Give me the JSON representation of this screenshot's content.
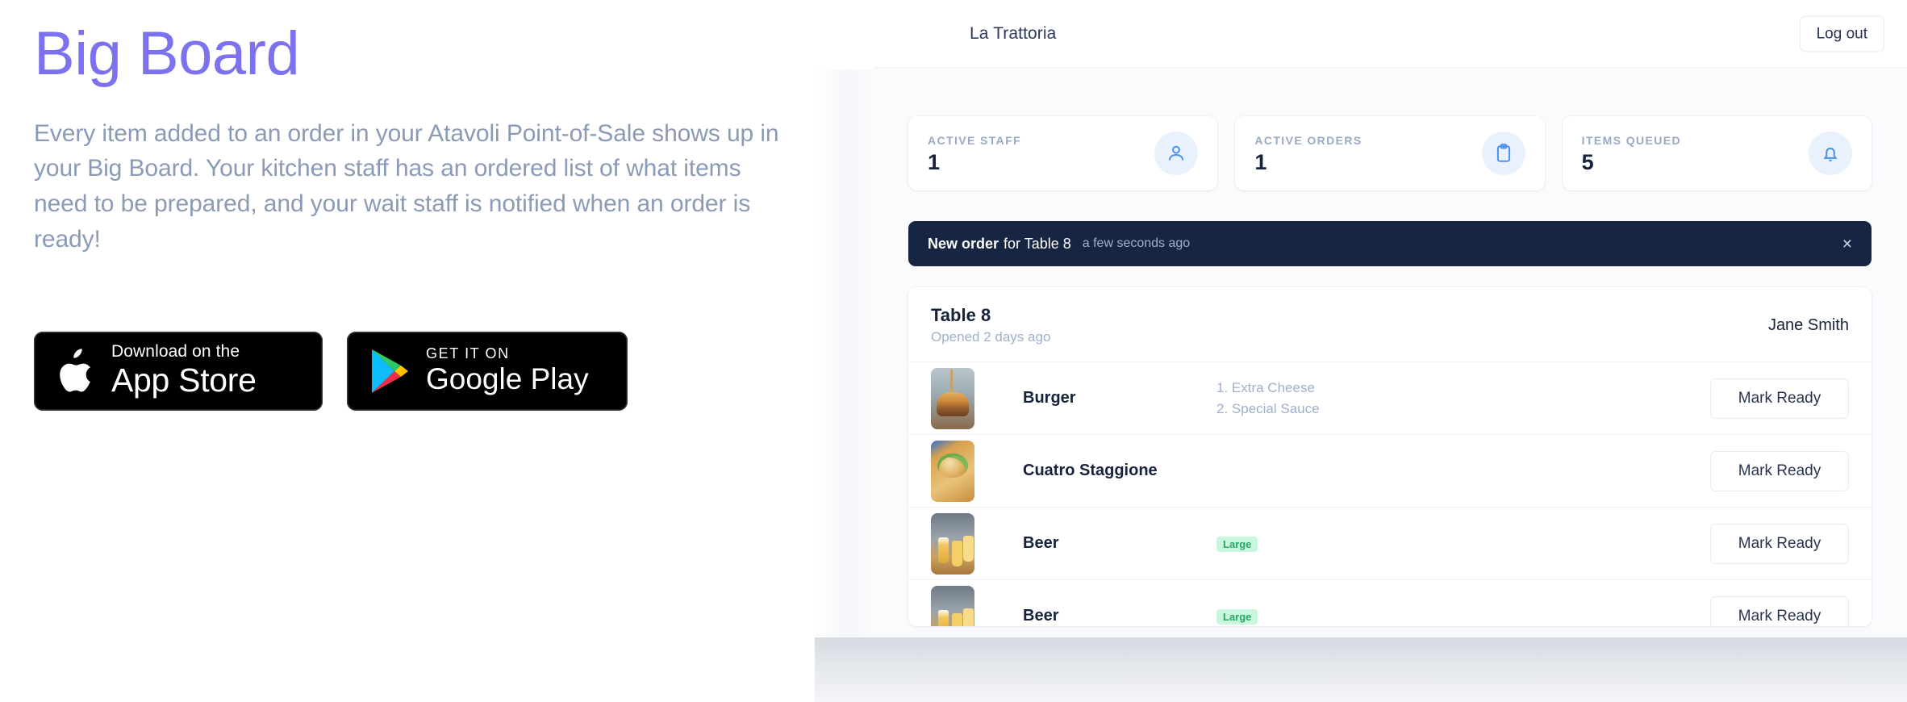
{
  "hero": {
    "title": "Big Board",
    "paragraph": "Every item added to an order in your Atavoli Point-of-Sale shows up in your Big Board. Your kitchen staff has an ordered list of what items need to be prepared, and your wait staff is notified when an order is ready!",
    "title_color": "#7c72f0",
    "paragraph_color": "#8b9ab5"
  },
  "badges": {
    "apple": {
      "small": "Download on the",
      "large": "App Store"
    },
    "google": {
      "small": "GET IT ON",
      "large": "Google Play"
    }
  },
  "app": {
    "topbar": {
      "brand": "La Trattoria",
      "logout_label": "Log out"
    },
    "stats": [
      {
        "label": "ACTIVE STAFF",
        "value": "1",
        "icon": "user-icon"
      },
      {
        "label": "ACTIVE ORDERS",
        "value": "1",
        "icon": "clipboard-icon"
      },
      {
        "label": "ITEMS QUEUED",
        "value": "5",
        "icon": "bell-icon"
      }
    ],
    "notification": {
      "strong": "New order",
      "normal": "for Table 8",
      "time": "a few seconds ago",
      "close_label": "×",
      "background": "#162642"
    },
    "order": {
      "table": "Table 8",
      "opened": "Opened 2 days ago",
      "server": "Jane Smith",
      "items": [
        {
          "name": "Burger",
          "modifiers": [
            "1. Extra Cheese",
            "2. Special Sauce"
          ],
          "size_badge": "",
          "action_label": "Mark Ready",
          "thumb": "burger-thumbnail"
        },
        {
          "name": "Cuatro Staggione",
          "modifiers": [],
          "size_badge": "",
          "action_label": "Mark Ready",
          "thumb": "pizza-thumbnail"
        },
        {
          "name": "Beer",
          "modifiers": [],
          "size_badge": "Large",
          "action_label": "Mark Ready",
          "thumb": "beer-thumbnail"
        },
        {
          "name": "Beer",
          "modifiers": [],
          "size_badge": "Large",
          "action_label": "Mark Ready",
          "thumb": "beer-thumbnail"
        }
      ]
    }
  }
}
